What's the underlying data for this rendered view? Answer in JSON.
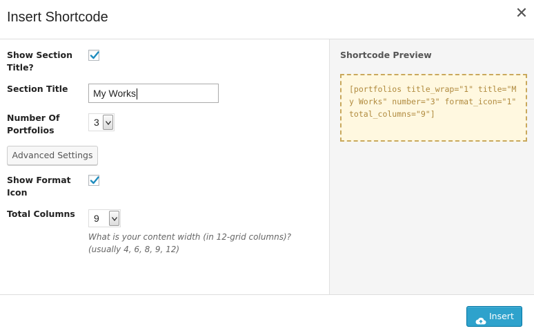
{
  "dialog": {
    "title": "Insert Shortcode",
    "close_glyph": "✕"
  },
  "form": {
    "show_section_title": {
      "label": "Show Section Title?",
      "checked": true
    },
    "section_title": {
      "label": "Section Title",
      "value": "My Works"
    },
    "number_of_portfolios": {
      "label": "Number Of Portfolios",
      "value": "3"
    },
    "advanced_settings_label": "Advanced Settings",
    "show_format_icon": {
      "label": "Show Format Icon",
      "checked": true
    },
    "total_columns": {
      "label": "Total Columns",
      "value": "9",
      "hint": "What is your content width (in 12-grid columns)? (usually 4, 6, 8, 9, 12)"
    }
  },
  "preview": {
    "label": "Shortcode Preview",
    "code": "[portfolios title_wrap=\"1\" title=\"My Works\" number=\"3\" format_icon=\"1\" total_columns=\"9\"]"
  },
  "footer": {
    "insert_label": "Insert",
    "insert_icon": "cloud-upload-icon"
  },
  "colors": {
    "accent": "#2ea2cc",
    "check": "#1e8cbe",
    "preview_bg": "#fff8e0",
    "preview_border": "#c9a85c",
    "preview_text": "#b08a3e"
  }
}
